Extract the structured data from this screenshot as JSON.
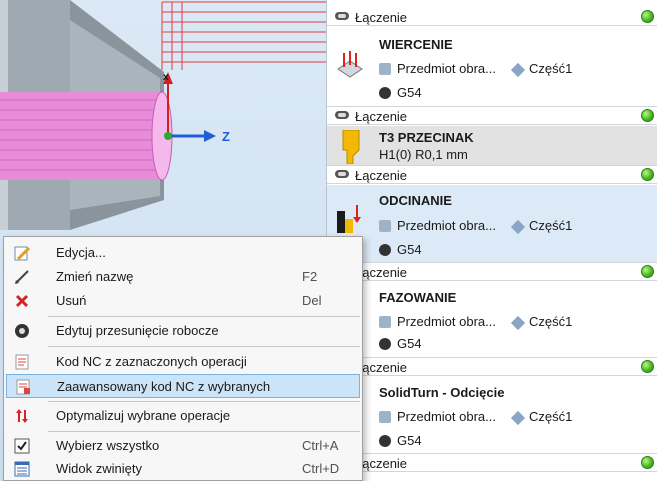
{
  "viewport": {
    "axis_label": "Z"
  },
  "operations": [
    {
      "type": "link",
      "label": "Łączenie"
    },
    {
      "type": "op",
      "name": "WIERCENIE",
      "workpiece": "Przedmiot obra...",
      "part": "Część1",
      "wcs": "G54"
    },
    {
      "type": "link",
      "label": "Łączenie"
    },
    {
      "type": "tool",
      "name": "T3 PRZECINAK",
      "detail": "H1(0) R0,1 mm"
    },
    {
      "type": "link",
      "label": "Łączenie"
    },
    {
      "type": "op",
      "name": "ODCINANIE",
      "workpiece": "Przedmiot obra...",
      "part": "Część1",
      "wcs": "G54"
    },
    {
      "type": "link",
      "label": "Łączenie"
    },
    {
      "type": "op",
      "name": "FAZOWANIE",
      "workpiece": "Przedmiot obra...",
      "part": "Część1",
      "wcs": "G54"
    },
    {
      "type": "link",
      "label": "Łączenie"
    },
    {
      "type": "op",
      "name": "SolidTurn - Odcięcie",
      "workpiece": "Przedmiot obra...",
      "part": "Część1",
      "wcs": "G54"
    },
    {
      "type": "link",
      "label": "Łączenie"
    }
  ],
  "context_menu": {
    "items": [
      {
        "label": "Edycja...",
        "shortcut": "",
        "icon": "edit-icon"
      },
      {
        "label": "Zmień nazwę",
        "shortcut": "F2",
        "icon": "pencil-icon"
      },
      {
        "label": "Usuń",
        "shortcut": "Del",
        "icon": "delete-icon"
      },
      {
        "label": "Edytuj przesunięcie robocze",
        "shortcut": "",
        "icon": "work-offset-icon"
      },
      {
        "label": "Kod NC z zaznaczonych operacji",
        "shortcut": "",
        "icon": "nc-code-icon"
      },
      {
        "label": "Zaawansowany kod NC z wybranych",
        "shortcut": "",
        "icon": "advanced-nc-icon"
      },
      {
        "label": "Optymalizuj wybrane operacje",
        "shortcut": "",
        "icon": "optimize-icon"
      },
      {
        "label": "Wybierz wszystko",
        "shortcut": "Ctrl+A",
        "icon": "select-all-icon"
      },
      {
        "label": "Widok zwinięty",
        "shortcut": "Ctrl+D",
        "icon": "collapsed-view-icon"
      }
    ],
    "highlighted_index": 5
  },
  "colors": {
    "selected_row": "#dce9f7",
    "menu_highlight": "#cce4f7",
    "status_green": "#3fb51a",
    "part_pink": "#e88bd8"
  }
}
